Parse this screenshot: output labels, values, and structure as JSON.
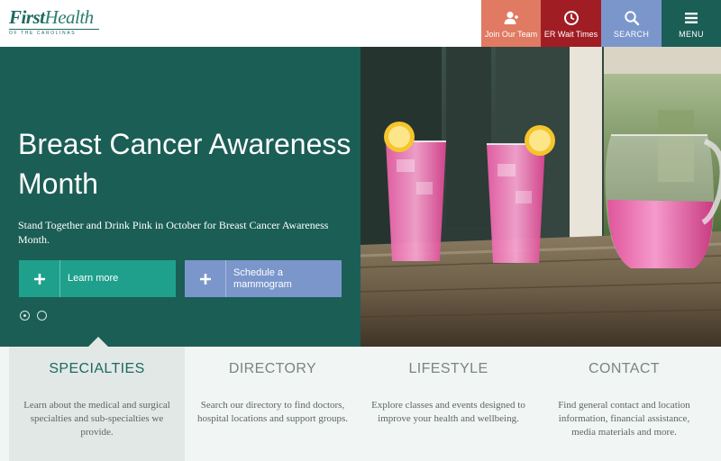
{
  "header": {
    "logo": {
      "name": "FirstHealth",
      "subtitle": "OF THE CAROLINAS"
    },
    "nav": [
      {
        "label": "Join Our Team",
        "icon": "user-icon"
      },
      {
        "label": "ER Wait Times",
        "icon": "clock-icon"
      },
      {
        "label": "SEARCH",
        "icon": "search-icon"
      },
      {
        "label": "MENU",
        "icon": "hamburger-icon"
      }
    ]
  },
  "hero": {
    "title": "Breast Cancer Awareness Month",
    "description": "Stand Together and Drink Pink in October for Breast Cancer Awareness Month.",
    "buttons": [
      {
        "label": "Learn more",
        "icon": "plus-icon"
      },
      {
        "label": "Schedule a mammogram",
        "icon": "plus-icon"
      }
    ],
    "carousel": {
      "slides": 2,
      "active": 1
    }
  },
  "tabs": [
    {
      "title": "SPECIALTIES",
      "description": "Learn about the medical and surgical specialties and sub-specialties we provide.",
      "active": true
    },
    {
      "title": "DIRECTORY",
      "description": "Search our directory to find doctors, hospital locations and support groups.",
      "active": false
    },
    {
      "title": "LIFESTYLE",
      "description": "Explore classes and events designed to improve your health and wellbeing.",
      "active": false
    },
    {
      "title": "CONTACT",
      "description": "Find general contact and location information, financial assistance, media materials and more.",
      "active": false
    }
  ],
  "colors": {
    "brand_green": "#1b5e55",
    "teal_button": "#1fa08d",
    "periwinkle": "#7b96cb",
    "coral": "#e07a63",
    "dark_red": "#a11d24"
  }
}
